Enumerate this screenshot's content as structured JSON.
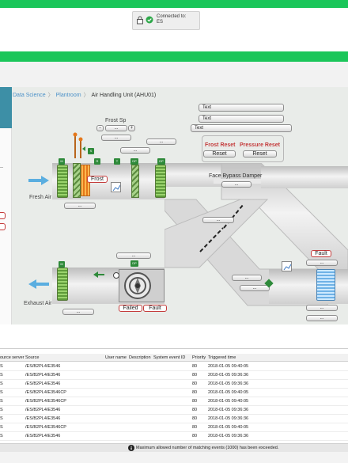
{
  "header": {
    "connection_label": "Connected to:",
    "connection_target": "ES"
  },
  "breadcrumb": [
    "Data Science",
    "Plantroom",
    "Air Handling Unit (AHU01)"
  ],
  "diagram": {
    "text_fields": [
      "Text",
      "Text",
      "Text"
    ],
    "frost_sp_label": "Frost Sp",
    "stepper_minus": "−",
    "stepper_plus": "+",
    "stepper_value": "...",
    "frost_label": "Frost",
    "frost_reset_label": "Frost Reset",
    "pressure_reset_label": "Pressure Reset",
    "reset_label": "Reset",
    "face_bypass_label": "Face Bypass Damper",
    "fresh_air_label": "Fresh Air",
    "exhaust_air_label": "Exhaust Air",
    "failed_label": "Failed",
    "fault_label": "Fault",
    "placeholder": "...",
    "badge_m": "M",
    "badge_dp": "DP",
    "badge_r": "R",
    "badge_t": "T",
    "badge_s": "S"
  },
  "events": {
    "columns": [
      "Source server",
      "Source",
      "User name",
      "Description",
      "System event ID",
      "Priority",
      "Triggered time"
    ],
    "column_labels": {
      "source_server": "ource server",
      "source": "Source",
      "user": "User name",
      "description": "Description",
      "event_id": "System event ID",
      "priority": "Priority",
      "triggered": "Triggered time"
    },
    "rows": [
      {
        "server": "S",
        "source": "/ES/B2PL4/E3546",
        "priority": "80",
        "time": "2018-01-05 09:40:05"
      },
      {
        "server": "S",
        "source": "/ES/B2PL4/E3546",
        "priority": "80",
        "time": "2018-01-05 09:36:36"
      },
      {
        "server": "S",
        "source": "/ES/B2PL4/E3546",
        "priority": "80",
        "time": "2018-01-05 09:36:36"
      },
      {
        "server": "S",
        "source": "/ES/B2PL4/E3546CP",
        "priority": "80",
        "time": "2018-01-05 09:40:05"
      },
      {
        "server": "S",
        "source": "/ES/B2PL4/E3546CP",
        "priority": "80",
        "time": "2018-01-05 09:40:05"
      },
      {
        "server": "S",
        "source": "/ES/B2PL4/E3546",
        "priority": "80",
        "time": "2018-01-05 09:36:36"
      },
      {
        "server": "S",
        "source": "/ES/B2PL4/E3546",
        "priority": "80",
        "time": "2018-01-05 09:36:36"
      },
      {
        "server": "S",
        "source": "/ES/B2PL4/E3546CP",
        "priority": "80",
        "time": "2018-01-05 09:40:05"
      },
      {
        "server": "S",
        "source": "/ES/B2PL4/E3546",
        "priority": "80",
        "time": "2018-01-05 09:36:36"
      }
    ],
    "footer_message": "Maximum allowed number of matching events (1000) has been exceeded."
  },
  "colors": {
    "brand_green": "#1bc65a",
    "alarm_red": "#c43b3b",
    "badge_green": "#2e8a3a",
    "link_blue": "#4a90c8"
  },
  "icons": [
    "lock-icon",
    "check-circle-icon",
    "chevron-right-icon",
    "fan-icon",
    "trend-graph-icon",
    "info-icon",
    "airflow-arrow-icon"
  ]
}
